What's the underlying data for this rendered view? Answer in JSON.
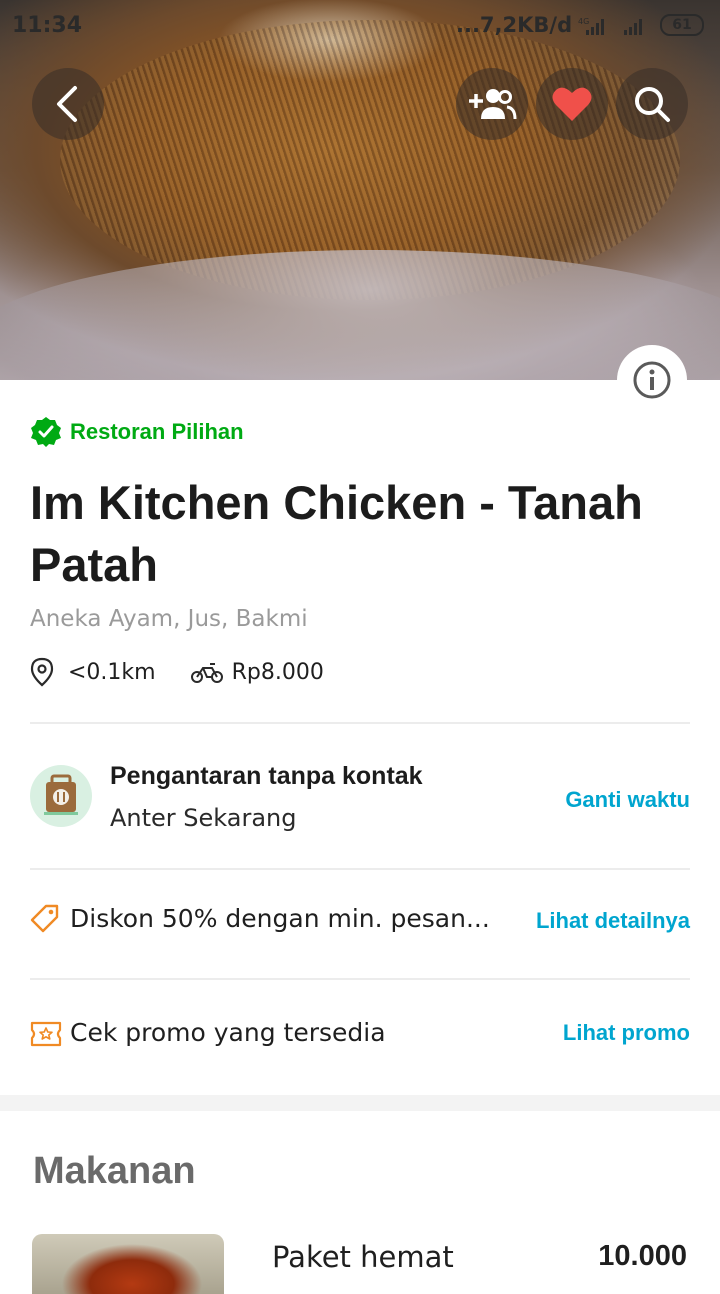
{
  "status_bar": {
    "time": "11:34",
    "network_speed": "...7,2KB/d",
    "network_type": "4G",
    "battery": "61"
  },
  "header": {
    "icons": [
      "back-icon",
      "add-friend-icon",
      "favorite-heart-icon",
      "search-icon",
      "info-icon"
    ],
    "heart_color": "#f0504a"
  },
  "restaurant": {
    "badge": "Restoran Pilihan",
    "badge_color": "#00aa13",
    "name": "Im Kitchen Chicken - Tanah Patah",
    "cuisine": "Aneka Ayam, Jus, Bakmi",
    "distance": "<0.1km",
    "delivery_fee": "Rp8.000"
  },
  "delivery": {
    "title": "Pengantaran tanpa kontak",
    "subtitle": "Anter Sekarang",
    "action": "Ganti waktu"
  },
  "discount": {
    "text": "Diskon 50% dengan min. pesan...",
    "action": "Lihat detailnya"
  },
  "promo": {
    "text": "Cek promo yang tersedia",
    "action": "Lihat promo"
  },
  "menu": {
    "section_title": "Makanan",
    "items": [
      {
        "name": "Paket hemat",
        "price": "10.000"
      }
    ]
  },
  "colors": {
    "link": "#00a5cf",
    "accent_orange": "#f08a24"
  }
}
